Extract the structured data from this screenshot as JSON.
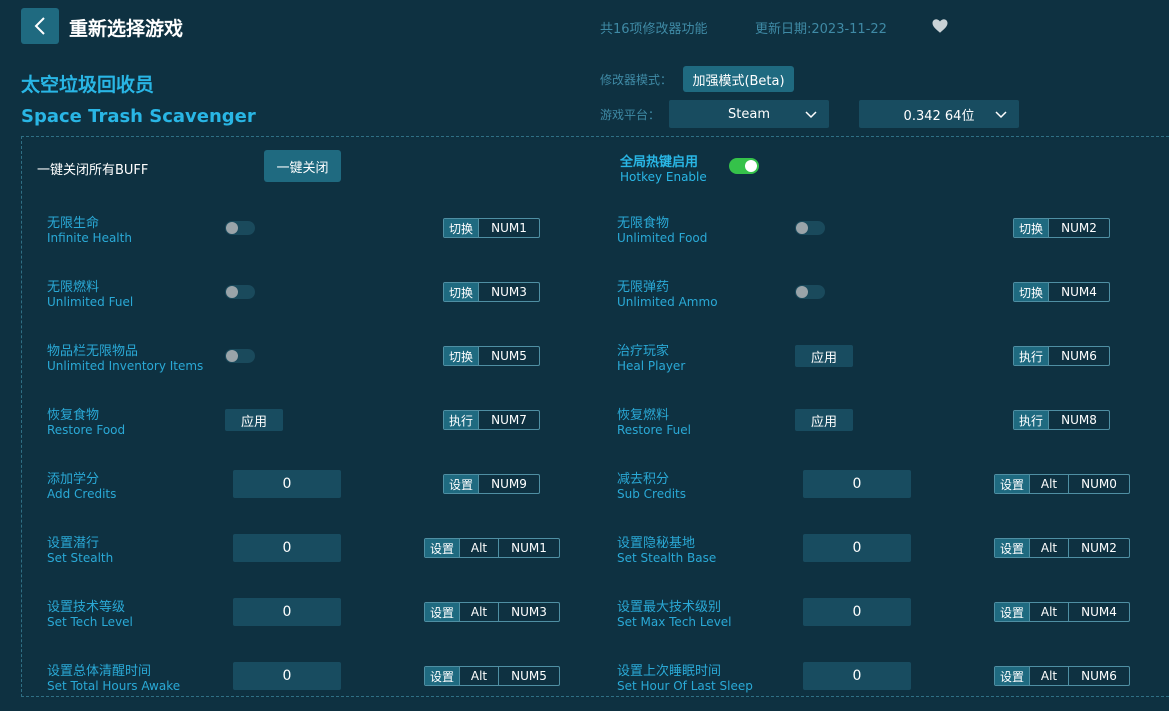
{
  "header": {
    "title": "重新选择游戏",
    "feature_count": "共16项修改器功能",
    "update_date": "更新日期:2023-11-22"
  },
  "game": {
    "name_cn": "太空垃圾回收员",
    "name_en": "Space Trash Scavenger"
  },
  "settings": {
    "mode_label": "修改器模式：",
    "mode_value": "加强模式(Beta)",
    "platform_label": "游戏平台：",
    "platform_value": "Steam",
    "version_value": "0.342 64位"
  },
  "panel": {
    "close_all_label": "一键关闭所有BUFF",
    "close_all_button": "一键关闭",
    "hotkey_enable_cn": "全局热键启用",
    "hotkey_enable_en": "Hotkey Enable",
    "hotkey_enabled": true
  },
  "features_left": [
    {
      "cn": "无限生命",
      "en": "Infinite Health",
      "control": "toggle",
      "on": false,
      "hk_tag": "切换",
      "keys": [
        "NUM1"
      ]
    },
    {
      "cn": "无限燃料",
      "en": "Unlimited Fuel",
      "control": "toggle",
      "on": false,
      "hk_tag": "切换",
      "keys": [
        "NUM3"
      ]
    },
    {
      "cn": "物品栏无限物品",
      "en": "Unlimited Inventory Items",
      "control": "toggle",
      "on": false,
      "hk_tag": "切换",
      "keys": [
        "NUM5"
      ]
    },
    {
      "cn": "恢复食物",
      "en": "Restore Food",
      "control": "apply",
      "button": "应用",
      "hk_tag": "执行",
      "keys": [
        "NUM7"
      ]
    },
    {
      "cn": "添加学分",
      "en": "Add Credits",
      "control": "input",
      "value": "0",
      "hk_tag": "设置",
      "keys": [
        "NUM9"
      ]
    },
    {
      "cn": "设置潜行",
      "en": "Set Stealth",
      "control": "input",
      "value": "0",
      "hk_tag": "设置",
      "keys": [
        "Alt",
        "NUM1"
      ]
    },
    {
      "cn": "设置技术等级",
      "en": "Set Tech Level",
      "control": "input",
      "value": "0",
      "hk_tag": "设置",
      "keys": [
        "Alt",
        "NUM3"
      ]
    },
    {
      "cn": "设置总体清醒时间",
      "en": "Set Total Hours Awake",
      "control": "input",
      "value": "0",
      "hk_tag": "设置",
      "keys": [
        "Alt",
        "NUM5"
      ]
    }
  ],
  "features_right": [
    {
      "cn": "无限食物",
      "en": "Unlimited Food",
      "control": "toggle",
      "on": false,
      "hk_tag": "切换",
      "keys": [
        "NUM2"
      ]
    },
    {
      "cn": "无限弹药",
      "en": "Unlimited Ammo",
      "control": "toggle",
      "on": false,
      "hk_tag": "切换",
      "keys": [
        "NUM4"
      ]
    },
    {
      "cn": "治疗玩家",
      "en": "Heal Player",
      "control": "apply",
      "button": "应用",
      "hk_tag": "执行",
      "keys": [
        "NUM6"
      ]
    },
    {
      "cn": "恢复燃料",
      "en": "Restore Fuel",
      "control": "apply",
      "button": "应用",
      "hk_tag": "执行",
      "keys": [
        "NUM8"
      ]
    },
    {
      "cn": "减去积分",
      "en": "Sub Credits",
      "control": "input",
      "value": "0",
      "hk_tag": "设置",
      "keys": [
        "Alt",
        "NUM0"
      ]
    },
    {
      "cn": "设置隐秘基地",
      "en": "Set Stealth Base",
      "control": "input",
      "value": "0",
      "hk_tag": "设置",
      "keys": [
        "Alt",
        "NUM2"
      ]
    },
    {
      "cn": "设置最大技术级别",
      "en": "Set Max Tech Level",
      "control": "input",
      "value": "0",
      "hk_tag": "设置",
      "keys": [
        "Alt",
        "NUM4"
      ]
    },
    {
      "cn": "设置上次睡眠时间",
      "en": "Set Hour Of Last Sleep",
      "control": "input",
      "value": "0",
      "hk_tag": "设置",
      "keys": [
        "Alt",
        "NUM6"
      ]
    }
  ]
}
